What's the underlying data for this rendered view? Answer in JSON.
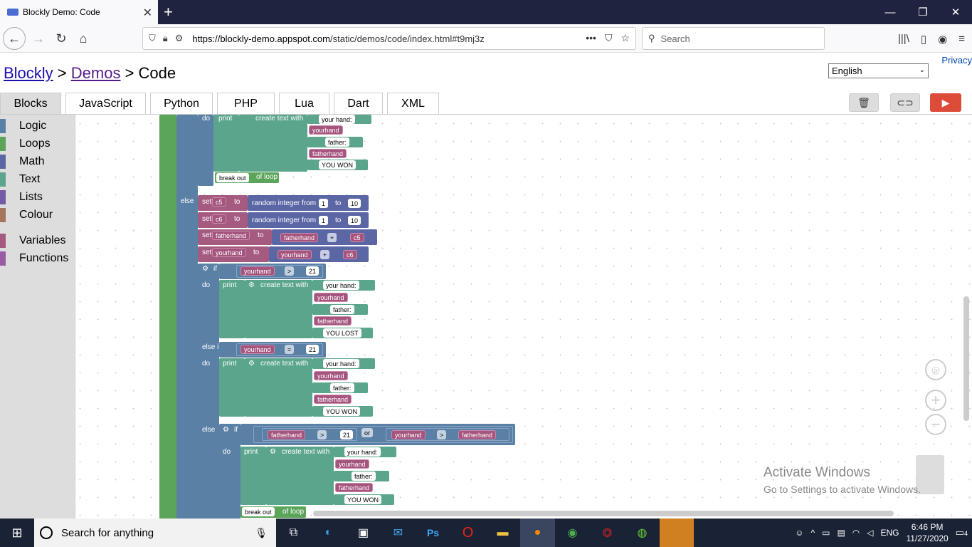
{
  "browser": {
    "tab_title": "Blockly Demo: Code",
    "url_host": "https://blockly-demo.appspot.com",
    "url_path": "/static/demos/code/index.html#t9mj3z",
    "search_placeholder": "Search"
  },
  "page": {
    "privacy": "Privacy",
    "crumb_blockly": "Blockly",
    "crumb_sep1": " > ",
    "crumb_demos": "Demos",
    "crumb_sep2": " > ",
    "crumb_code": "Code",
    "language": "English",
    "tabs": [
      "Blocks",
      "JavaScript",
      "Python",
      "PHP",
      "Lua",
      "Dart",
      "XML"
    ]
  },
  "toolbox": {
    "categories": [
      {
        "label": "Logic",
        "color": "#5b80a5"
      },
      {
        "label": "Loops",
        "color": "#5ba55b"
      },
      {
        "label": "Math",
        "color": "#5b67a5"
      },
      {
        "label": "Text",
        "color": "#5ba58c"
      },
      {
        "label": "Lists",
        "color": "#745ba5"
      },
      {
        "label": "Colour",
        "color": "#a5745b"
      },
      {
        "label": "Variables",
        "color": "#a55b80"
      },
      {
        "label": "Functions",
        "color": "#995ba5"
      }
    ]
  },
  "blocks": {
    "do": "do",
    "print": "print",
    "create_text_with": "create text with",
    "your_hand": "your hand:",
    "yourhand": "yourhand",
    "father": "father:",
    "fatherhand": "fatherhand",
    "you_won": "YOU WON",
    "you_lost": "YOU LOST",
    "break_out": "break out",
    "of_loop": "of loop",
    "else": "else",
    "else_if": "else if",
    "if": "if",
    "set": "set",
    "to": "to",
    "c5": "c5",
    "c6": "c6",
    "random_integer_from": "random integer from",
    "one": "1",
    "ten": "10",
    "plus": "+",
    "gt": ">",
    "eq": "=",
    "or": "or",
    "twentyone": "21"
  },
  "watermark": {
    "line1": "Activate Windows",
    "line2": "Go to Settings to activate Windows."
  },
  "taskbar": {
    "search_text": "Search for anything",
    "lang": "ENG",
    "time": "6:46 PM",
    "date": "11/27/2020",
    "notifications": "4"
  }
}
